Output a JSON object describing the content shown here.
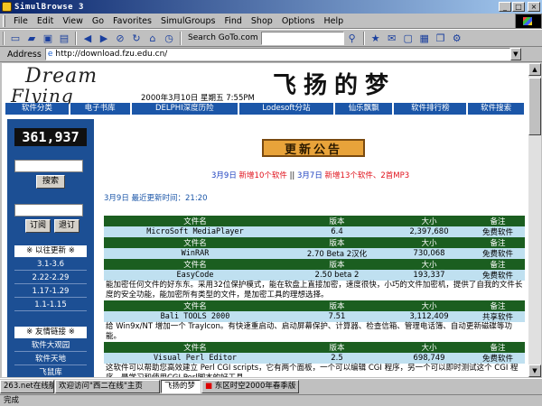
{
  "window": {
    "title": "SimulBrowse 3"
  },
  "menu": [
    "File",
    "Edit",
    "View",
    "Go",
    "Favorites",
    "SimulGroups",
    "Find",
    "Shop",
    "Options",
    "Help"
  ],
  "toolbar": {
    "search_label": "Search GoTo.com",
    "icons": [
      "new-page-icon",
      "open-folder-icon",
      "save-icon",
      "print-icon",
      "back-icon",
      "forward-icon",
      "stop-icon",
      "refresh-icon",
      "home-icon",
      "search-icon",
      "history-icon",
      "favorites-icon",
      "mail-icon",
      "fullscreen-icon",
      "tile-icon",
      "cascade-icon",
      "settings-icon"
    ]
  },
  "address": {
    "label": "Address",
    "url": "http://download.fzu.edu.cn/"
  },
  "page": {
    "logo_top": "Dream",
    "logo_bottom": "Flying",
    "big_title": "飞扬的梦",
    "datetime": "2000年3月10日 星期五 7:55PM",
    "nav": [
      "软件分类",
      "电子书库",
      "DELPHI深度历险",
      "Lodesoft分站",
      "仙乐飘飘",
      "软件排行榜",
      "软件搜索"
    ],
    "counter": "361,937",
    "search_button": "搜索",
    "subscribe_button": "订阅",
    "unsubscribe_button": "退订",
    "history_header": "※  以往更新  ※",
    "history_items": [
      "3.1-3.6",
      "2.22-2.29",
      "1.17-1.29",
      "1.1-1.15"
    ],
    "links_header": "※  友情链接  ※",
    "links_items": [
      "软件大观园",
      "软件天地",
      "飞鼠库"
    ],
    "notice_title": "更新公告",
    "update_line": {
      "d1": "3月9日",
      "t1": "新增10个软件",
      "sep": " || ",
      "d2": "3月7日",
      "t2": "新增13个软件、2首MP3"
    },
    "last_update": "3月9日 最近更新时间：21:20",
    "table_headers": [
      "文件名",
      "版本",
      "大小",
      "备注"
    ],
    "software": [
      {
        "name": "MicroSoft MediaPlayer",
        "version": "6.4",
        "size": "2,397,680",
        "note": "免费软件",
        "desc": ""
      },
      {
        "name": "WinRAR",
        "version": "2.70 Beta 2汉化",
        "size": "730,068",
        "note": "免费软件",
        "desc": ""
      },
      {
        "name": "EasyCode",
        "version": "2.50 beta 2",
        "size": "193,337",
        "note": "免费软件",
        "desc": "能加密任何文件的好东东。采用32位保护模式，能在软盘上直接加密，速度很快，小巧的文件加密机，提供了自我的文件长度的安全功能，能加密所有类型的文件，是加密工具的理想选择。"
      },
      {
        "name": "Bali TOOLS 2000",
        "version": "7.51",
        "size": "3,112,409",
        "note": "共享软件",
        "desc": "给 Win9x/NT 增加一个 TrayIcon。有快速重启动、启动屏幕保护、计算器、检查信箱、管理电话簿、自动更新磁碟等功能。"
      },
      {
        "name": "Visual Perl Editor",
        "version": "2.5",
        "size": "698,749",
        "note": "免费软件",
        "desc": "这软件可以帮助您高效建立 Perl CGI scripts，它有两个面板，一个可以编辑 CGI 程序，另一个可以即时测试这个 CGI 程序。是学习和使用CGI Perl脚本的好工具。"
      }
    ]
  },
  "taskbar": {
    "tasks": [
      "263.net在线航局",
      "欢迎访问\"西二在线\"主页",
      "飞扬的梦",
      "东区时空2000年春季版"
    ]
  },
  "status": "完成"
}
